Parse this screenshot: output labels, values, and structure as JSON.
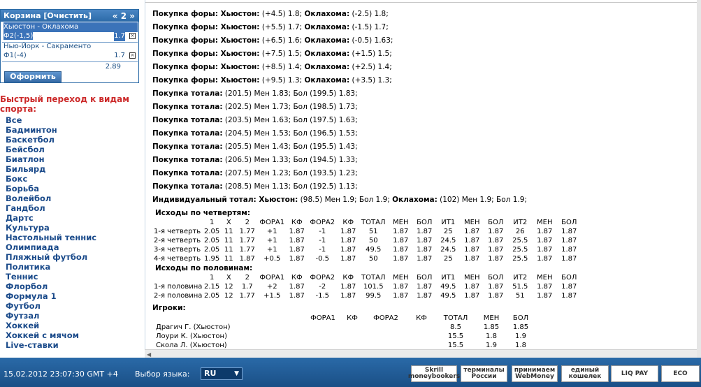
{
  "basket": {
    "title": "Корзина [Очистить]",
    "pager": "« 2 »",
    "bets": [
      {
        "match": "Хьюстон - Оклахома",
        "bet": "Ф2(-1,5)",
        "coef": "1.7"
      },
      {
        "match": "Нью-Йорк - Сакраменто",
        "bet": "Ф1(-4)",
        "coef": "1.7"
      }
    ],
    "total": "2.89",
    "checkout": "Оформить"
  },
  "quick_nav": {
    "title": "Быстрый переход к видам спорта:",
    "sports": [
      "Все",
      "Бадминтон",
      "Баскетбол",
      "Бейсбол",
      "Биатлон",
      "Бильярд",
      "Бокс",
      "Борьба",
      "Волейбол",
      "Гандбол",
      "Дартс",
      "Культура",
      "Настольный теннис",
      "Олимпиада",
      "Пляжный футбол",
      "Политика",
      "Теннис",
      "Флорбол",
      "Формула 1",
      "Футбол",
      "Футзал",
      "Хоккей",
      "Хоккей с мячом",
      "Live-ставки"
    ]
  },
  "lines": [
    {
      "label": "Покупка форы: Хьюстон:",
      "a": " (+4.5) 1.8; ",
      "label2": "Оклахома:",
      "b": " (-2.5) 1.8;"
    },
    {
      "label": "Покупка форы: Хьюстон:",
      "a": " (+5.5) 1.7; ",
      "label2": "Оклахома:",
      "b": " (-1.5) 1.7;"
    },
    {
      "label": "Покупка форы: Хьюстон:",
      "a": " (+6.5) 1.6; ",
      "label2": "Оклахома:",
      "b": " (-0.5) 1.63;"
    },
    {
      "label": "Покупка форы: Хьюстон:",
      "a": " (+7.5) 1.5; ",
      "label2": "Оклахома:",
      "b": " (+1.5) 1.5;"
    },
    {
      "label": "Покупка форы: Хьюстон:",
      "a": " (+8.5) 1.4; ",
      "label2": "Оклахома:",
      "b": " (+2.5) 1.4;"
    },
    {
      "label": "Покупка форы: Хьюстон:",
      "a": " (+9.5) 1.3; ",
      "label2": "Оклахома:",
      "b": " (+3.5) 1.3;"
    },
    {
      "label": "Покупка тотала:",
      "a": " (201.5) Мен 1.83; Бол (199.5) 1.83;",
      "label2": "",
      "b": ""
    },
    {
      "label": "Покупка тотала:",
      "a": " (202.5) Мен 1.73; Бол (198.5) 1.73;",
      "label2": "",
      "b": ""
    },
    {
      "label": "Покупка тотала:",
      "a": " (203.5) Мен 1.63; Бол (197.5) 1.63;",
      "label2": "",
      "b": ""
    },
    {
      "label": "Покупка тотала:",
      "a": " (204.5) Мен 1.53; Бол (196.5) 1.53;",
      "label2": "",
      "b": ""
    },
    {
      "label": "Покупка тотала:",
      "a": " (205.5) Мен 1.43; Бол (195.5) 1.43;",
      "label2": "",
      "b": ""
    },
    {
      "label": "Покупка тотала:",
      "a": " (206.5) Мен 1.33; Бол (194.5) 1.33;",
      "label2": "",
      "b": ""
    },
    {
      "label": "Покупка тотала:",
      "a": " (207.5) Мен 1.23; Бол (193.5) 1.23;",
      "label2": "",
      "b": ""
    },
    {
      "label": "Покупка тотала:",
      "a": " (208.5) Мен 1.13; Бол (192.5) 1.13;",
      "label2": "",
      "b": ""
    },
    {
      "label": "Индивидуальный тотал: Хьюстон:",
      "a": " (98.5) Мен 1.9; Бол 1.9; ",
      "label2": "Оклахома:",
      "b": " (102) Мен 1.9; Бол 1.9;"
    }
  ],
  "quarters": {
    "title": "Исходы по четвертям:",
    "headers": [
      "",
      "1",
      "X",
      "2",
      "ФОРА1",
      "КФ",
      "ФОРА2",
      "КФ",
      "ТОТАЛ",
      "МЕН",
      "БОЛ",
      "ИТ1",
      "МЕН",
      "БОЛ",
      "ИТ2",
      "МЕН",
      "БОЛ"
    ],
    "rows": [
      [
        "1-я четверть",
        "2.05",
        "11",
        "1.77",
        "+1",
        "1.87",
        "-1",
        "1.87",
        "51",
        "1.87",
        "1.87",
        "25",
        "1.87",
        "1.87",
        "26",
        "1.87",
        "1.87"
      ],
      [
        "2-я четверть",
        "2.05",
        "11",
        "1.77",
        "+1",
        "1.87",
        "-1",
        "1.87",
        "50",
        "1.87",
        "1.87",
        "24.5",
        "1.87",
        "1.87",
        "25.5",
        "1.87",
        "1.87"
      ],
      [
        "3-я четверть",
        "2.05",
        "11",
        "1.77",
        "+1",
        "1.87",
        "-1",
        "1.87",
        "49.5",
        "1.87",
        "1.87",
        "24.5",
        "1.87",
        "1.87",
        "25.5",
        "1.87",
        "1.87"
      ],
      [
        "4-я четверть",
        "1.95",
        "11",
        "1.87",
        "+0.5",
        "1.87",
        "-0.5",
        "1.87",
        "50",
        "1.87",
        "1.87",
        "25",
        "1.87",
        "1.87",
        "25.5",
        "1.87",
        "1.87"
      ]
    ]
  },
  "halves": {
    "title": "Исходы по половинам:",
    "headers": [
      "",
      "1",
      "X",
      "2",
      "ФОРА1",
      "КФ",
      "ФОРА2",
      "КФ",
      "ТОТАЛ",
      "МЕН",
      "БОЛ",
      "ИТ1",
      "МЕН",
      "БОЛ",
      "ИТ2",
      "МЕН",
      "БОЛ"
    ],
    "rows": [
      [
        "1-я половина",
        "2.15",
        "12",
        "1.7",
        "+2",
        "1.87",
        "-2",
        "1.87",
        "101.5",
        "1.87",
        "1.87",
        "49.5",
        "1.87",
        "1.87",
        "51.5",
        "1.87",
        "1.87"
      ],
      [
        "2-я половина",
        "2.05",
        "12",
        "1.77",
        "+1.5",
        "1.87",
        "-1.5",
        "1.87",
        "99.5",
        "1.87",
        "1.87",
        "49.5",
        "1.87",
        "1.87",
        "51",
        "1.87",
        "1.87"
      ]
    ]
  },
  "players": {
    "title": "Игроки:",
    "headers": [
      "",
      "ФОРА1",
      "КФ",
      "ФОРА2",
      "КФ",
      "ТОТАЛ",
      "МЕН",
      "БОЛ"
    ],
    "rows": [
      [
        "Драгич Г. (Хьюстон)",
        "",
        "",
        "",
        "",
        "8.5",
        "1.85",
        "1.85"
      ],
      [
        "Лоури К. (Хьюстон)",
        "",
        "",
        "",
        "",
        "15.5",
        "1.8",
        "1.9"
      ],
      [
        "Скола Л. (Хьюстон)",
        "",
        "",
        "",
        "",
        "15.5",
        "1.9",
        "1.8"
      ]
    ]
  },
  "footer": {
    "datetime": "15.02.2012  23:07:30  GMT +4",
    "lang_label": "Выбор языка:",
    "lang_value": "RU",
    "logos": [
      {
        "name": "skrill",
        "text": "Skrill moneybookers"
      },
      {
        "name": "terminals",
        "text": "терминалы России"
      },
      {
        "name": "webmoney",
        "text": "принимаем WebMoney"
      },
      {
        "name": "wallet",
        "text": "единый кошелек"
      },
      {
        "name": "liqpay",
        "text": "LIQ PAY"
      },
      {
        "name": "eco",
        "text": "ECO"
      }
    ]
  },
  "colors": {
    "brand_blue": "#1a4f86",
    "link_blue": "#1a4a8a",
    "accent_red": "#cc2a2a"
  }
}
